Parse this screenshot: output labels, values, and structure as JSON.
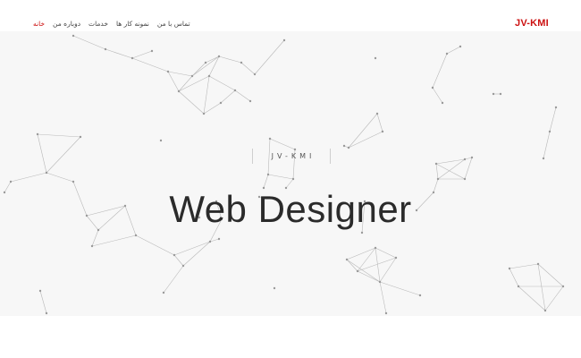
{
  "header": {
    "brand": "JV-KMI",
    "nav": [
      {
        "label": "خانه",
        "active": true
      },
      {
        "label": "دوباره من",
        "active": false
      },
      {
        "label": "خدمات",
        "active": false
      },
      {
        "label": "نمونه کار ها",
        "active": false
      },
      {
        "label": "تماس با من",
        "active": false
      }
    ]
  },
  "hero": {
    "subtitle": "JV-KMI",
    "title": "Web Designer",
    "background_color": "#f7f7f7"
  },
  "colors": {
    "accent": "#cc1111",
    "text": "#2b2b2b",
    "network": "#b9b9b9"
  }
}
